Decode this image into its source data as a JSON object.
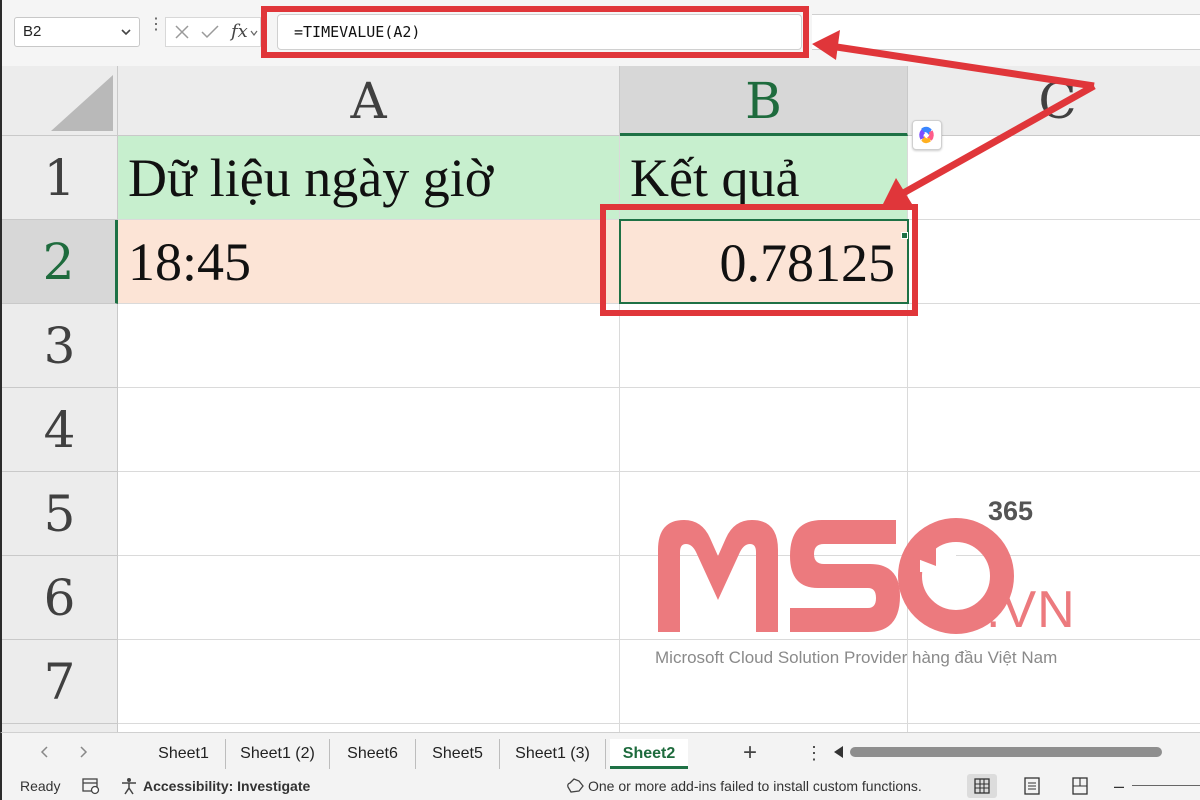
{
  "formula_bar": {
    "name_box": "B2",
    "fx_label": "fx",
    "formula": "=TIMEVALUE(A2)"
  },
  "columns": [
    {
      "label": "A",
      "selected": false
    },
    {
      "label": "B",
      "selected": true
    },
    {
      "label": "C",
      "selected": false
    }
  ],
  "rows": [
    "1",
    "2",
    "3",
    "4",
    "5",
    "6",
    "7"
  ],
  "cells": {
    "A1": "Dữ liệu ngày giờ",
    "B1": "Kết quả",
    "A2": "18:45",
    "B2": "0.78125"
  },
  "active_cell": "B2",
  "watermark": {
    "logo_text": "MSO",
    "superscript": "365",
    "domain": ".VN",
    "caption": "Microsoft Cloud Solution Provider hàng đầu Việt Nam"
  },
  "sheet_tabs": [
    {
      "label": "Sheet1",
      "active": false
    },
    {
      "label": "Sheet1 (2)",
      "active": false
    },
    {
      "label": "Sheet6",
      "active": false
    },
    {
      "label": "Sheet5",
      "active": false
    },
    {
      "label": "Sheet1 (3)",
      "active": false
    },
    {
      "label": "Sheet2",
      "active": true
    }
  ],
  "add_sheet_label": "+",
  "status_bar": {
    "ready": "Ready",
    "accessibility": "Accessibility: Investigate",
    "addin_message": "One or more add-ins failed to install custom functions."
  },
  "colors": {
    "header_fill": "#c7efce",
    "data_fill": "#fce4d6",
    "excel_green": "#1e7145",
    "annotation_red": "#e0363a",
    "watermark_pink": "#ec7a7e"
  }
}
